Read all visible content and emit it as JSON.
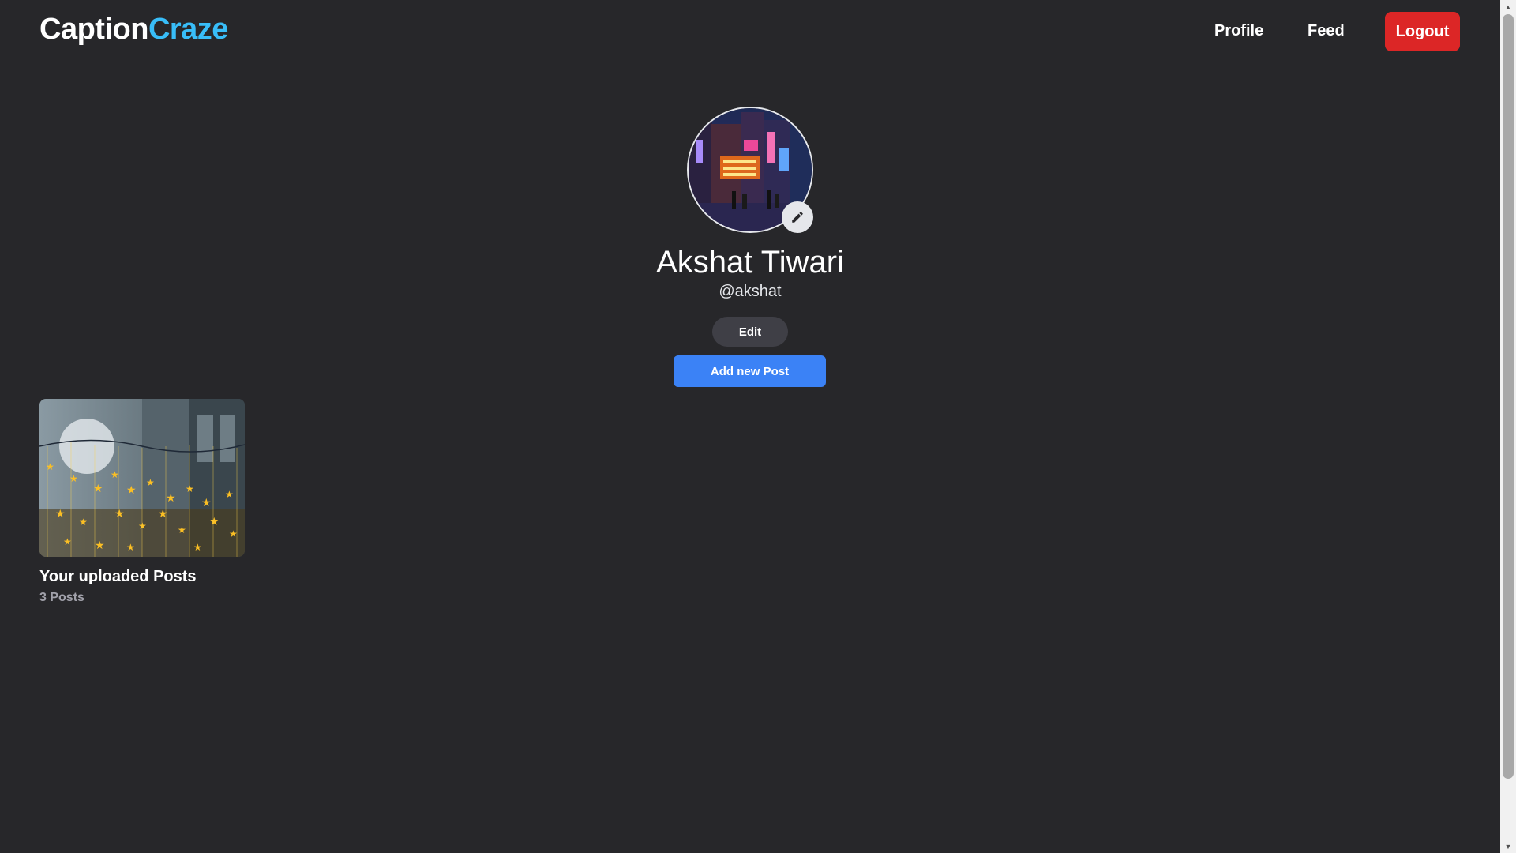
{
  "navbar": {
    "logo_part1": "Caption",
    "logo_part2": "Craze",
    "profile_label": "Profile",
    "feed_label": "Feed",
    "logout_label": "Logout"
  },
  "profile": {
    "name": "Akshat Tiwari",
    "username": "@akshat",
    "edit_label": "Edit",
    "add_post_label": "Add new Post"
  },
  "posts": {
    "title": "Your uploaded Posts",
    "count": "3 Posts"
  },
  "icons": {
    "edit_avatar": "pencil-icon",
    "scroll_up": "triangle-up-icon",
    "scroll_down": "triangle-down-icon"
  },
  "colors": {
    "background": "#27272a",
    "brand_accent": "#38bdf8",
    "logout": "#dc2626",
    "primary": "#3b82f6",
    "secondary_button": "#3f3f46"
  }
}
